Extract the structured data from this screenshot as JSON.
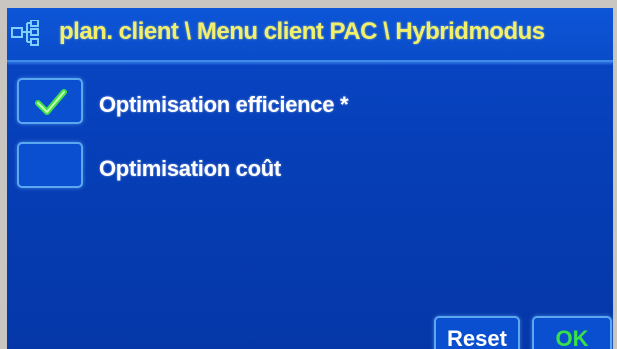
{
  "header": {
    "title": "plan. client \\ Menu client PAC \\ Hybridmodus",
    "icon": "tree-structure-icon"
  },
  "options": [
    {
      "label": "Optimisation efficience *",
      "checked": true
    },
    {
      "label": "Optimisation coût",
      "checked": false
    }
  ],
  "buttons": {
    "reset_label": "Reset",
    "ok_label": "OK"
  },
  "colors": {
    "background": "#063fb8",
    "title_text": "#f2f06a",
    "border_accent": "#5aa8f0",
    "check": "#3fe04a",
    "ok_text": "#38e04a"
  }
}
